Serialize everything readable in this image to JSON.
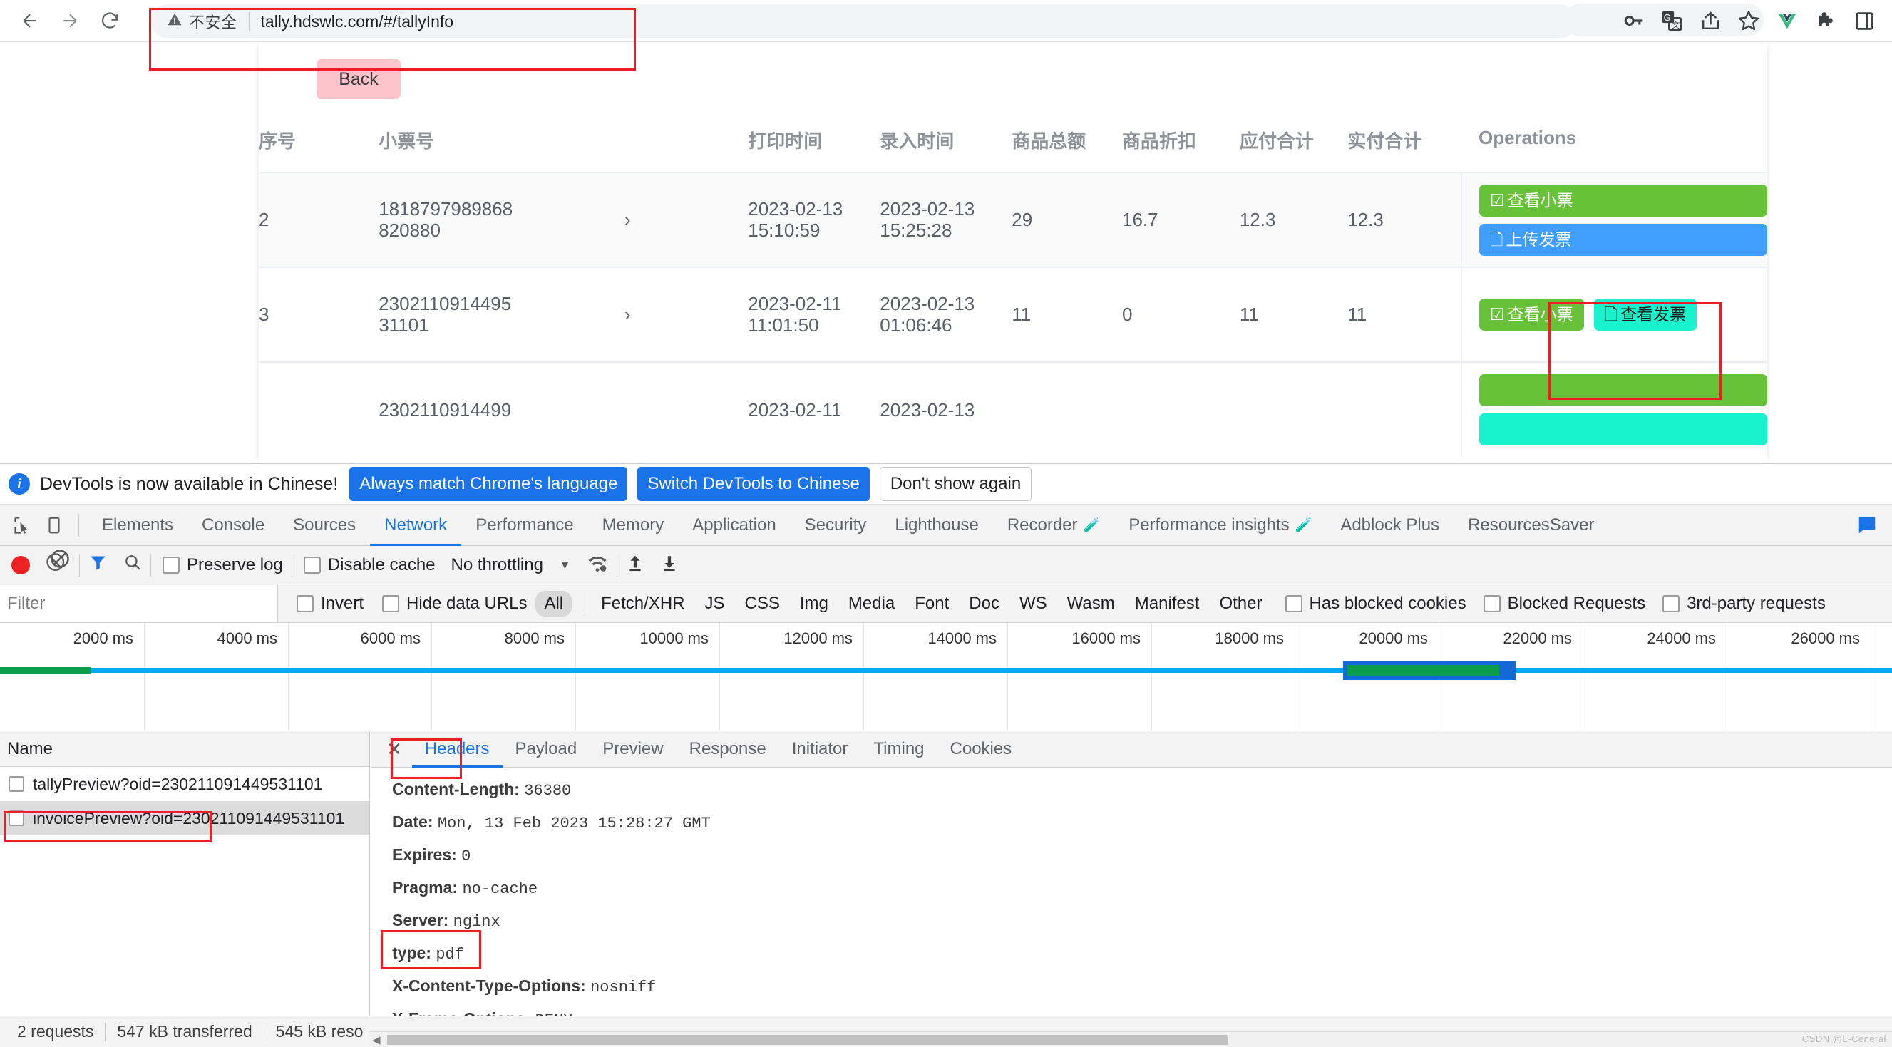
{
  "browser": {
    "back_icon": "arrow-left-icon",
    "forward_icon": "arrow-right-icon",
    "reload_icon": "reload-icon",
    "security_icon": "warning-triangle-icon",
    "security_label": "不安全",
    "url": "tally.hdswlc.com/#/tallyInfo",
    "toolbar_icons": [
      "key-icon",
      "translate-icon",
      "share-icon",
      "star-icon",
      "vue-devtools-icon",
      "extensions-puzzle-icon",
      "sidebar-panel-icon"
    ]
  },
  "page": {
    "back_button": "Back",
    "table": {
      "headers": [
        "序号",
        "小票号",
        "",
        "打印时间",
        "录入时间",
        "商品总额",
        "商品折扣",
        "应付合计",
        "实付合计",
        "Operations"
      ],
      "rows": [
        {
          "seq": "2",
          "ticket_line1": "1818797989868",
          "ticket_line2": "820880",
          "arrow": "›",
          "print_date": "2023-02-13",
          "print_time": "15:10:59",
          "entry_date": "2023-02-13",
          "entry_time": "15:25:28",
          "goods_total": "29",
          "discount": "16.7",
          "due_total": "12.3",
          "paid_total": "12.3",
          "ops": [
            "查看小票",
            "上传发票"
          ]
        },
        {
          "seq": "3",
          "ticket_line1": "2302110914495",
          "ticket_line2": "31101",
          "arrow": "›",
          "print_date": "2023-02-11",
          "print_time": "11:01:50",
          "entry_date": "2023-02-13",
          "entry_time": "01:06:46",
          "goods_total": "11",
          "discount": "0",
          "due_total": "11",
          "paid_total": "11",
          "ops": [
            "查看小票",
            "查看发票"
          ]
        },
        {
          "seq": "",
          "ticket_line1": "2302110914499",
          "ticket_line2": "",
          "arrow": "",
          "print_date": "2023-02-11",
          "print_time": "",
          "entry_date": "2023-02-13",
          "entry_time": "",
          "goods_total": "",
          "discount": "",
          "due_total": "",
          "paid_total": "",
          "ops": []
        }
      ]
    }
  },
  "devtools": {
    "notice": {
      "icon": "info-icon",
      "text": "DevTools is now available in Chinese!",
      "primary_button": "Always match Chrome's language",
      "secondary_button": "Switch DevTools to Chinese",
      "dismiss_button": "Don't show again"
    },
    "tabs": [
      {
        "label": "Elements",
        "active": false,
        "flask": false
      },
      {
        "label": "Console",
        "active": false,
        "flask": false
      },
      {
        "label": "Sources",
        "active": false,
        "flask": false
      },
      {
        "label": "Network",
        "active": true,
        "flask": false
      },
      {
        "label": "Performance",
        "active": false,
        "flask": false
      },
      {
        "label": "Memory",
        "active": false,
        "flask": false
      },
      {
        "label": "Application",
        "active": false,
        "flask": false
      },
      {
        "label": "Security",
        "active": false,
        "flask": false
      },
      {
        "label": "Lighthouse",
        "active": false,
        "flask": false
      },
      {
        "label": "Recorder",
        "active": false,
        "flask": true
      },
      {
        "label": "Performance insights",
        "active": false,
        "flask": true
      },
      {
        "label": "Adblock Plus",
        "active": false,
        "flask": false
      },
      {
        "label": "ResourcesSaver",
        "active": false,
        "flask": false
      }
    ],
    "toolbar": {
      "record_icon": "record-dot-icon",
      "clear_icon": "clear-icon",
      "filter_icon": "funnel-icon",
      "search_icon": "search-icon",
      "preserve_log": "Preserve log",
      "disable_cache": "Disable cache",
      "throttling": "No throttling",
      "caret_icon": "chevron-down-icon",
      "network_conditions_icon": "wifi-gear-icon",
      "import_icon": "upload-arrow-icon",
      "export_icon": "download-arrow-icon"
    },
    "filterbar": {
      "filter_placeholder": "Filter",
      "invert": "Invert",
      "hide_data_urls": "Hide data URLs",
      "types": [
        "All",
        "Fetch/XHR",
        "JS",
        "CSS",
        "Img",
        "Media",
        "Font",
        "Doc",
        "WS",
        "Wasm",
        "Manifest",
        "Other"
      ],
      "selected_type": "All",
      "has_blocked_cookies": "Has blocked cookies",
      "blocked_requests": "Blocked Requests",
      "third_party_requests": "3rd-party requests"
    },
    "overview": {
      "ticks": [
        "2000 ms",
        "4000 ms",
        "6000 ms",
        "8000 ms",
        "10000 ms",
        "12000 ms",
        "14000 ms",
        "16000 ms",
        "18000 ms",
        "20000 ms",
        "22000 ms",
        "24000 ms",
        "26000 ms"
      ]
    },
    "requests": {
      "column_header": "Name",
      "items": [
        {
          "name": "tallyPreview?oid=230211091449531101",
          "selected": false
        },
        {
          "name": "invoicePreview?oid=230211091449531101",
          "selected": true
        }
      ]
    },
    "details": {
      "close_icon": "close-icon",
      "tabs": [
        "Headers",
        "Payload",
        "Preview",
        "Response",
        "Initiator",
        "Timing",
        "Cookies"
      ],
      "active_tab": "Headers",
      "headers": [
        {
          "name": "Content-Length:",
          "value": "36380"
        },
        {
          "name": "Date:",
          "value": "Mon, 13 Feb 2023 15:28:27 GMT"
        },
        {
          "name": "Expires:",
          "value": "0"
        },
        {
          "name": "Pragma:",
          "value": "no-cache"
        },
        {
          "name": "Server:",
          "value": "nginx"
        },
        {
          "name": "type:",
          "value": "pdf"
        },
        {
          "name": "X-Content-Type-Options:",
          "value": "nosniff"
        },
        {
          "name": "X-Frame-Options:",
          "value": "DENY"
        }
      ]
    },
    "status": {
      "requests": "2 requests",
      "transferred": "547 kB transferred",
      "resources": "545 kB reso"
    }
  },
  "colors": {
    "accent_blue": "#1a73e8",
    "annotation_red": "#ee1c25",
    "btn_green": "#67c23a",
    "btn_blue": "#409eff",
    "btn_cyan": "#18f2cd",
    "back_pink": "#fbc4cb"
  },
  "watermark": "CSDN @L-Ceneral"
}
